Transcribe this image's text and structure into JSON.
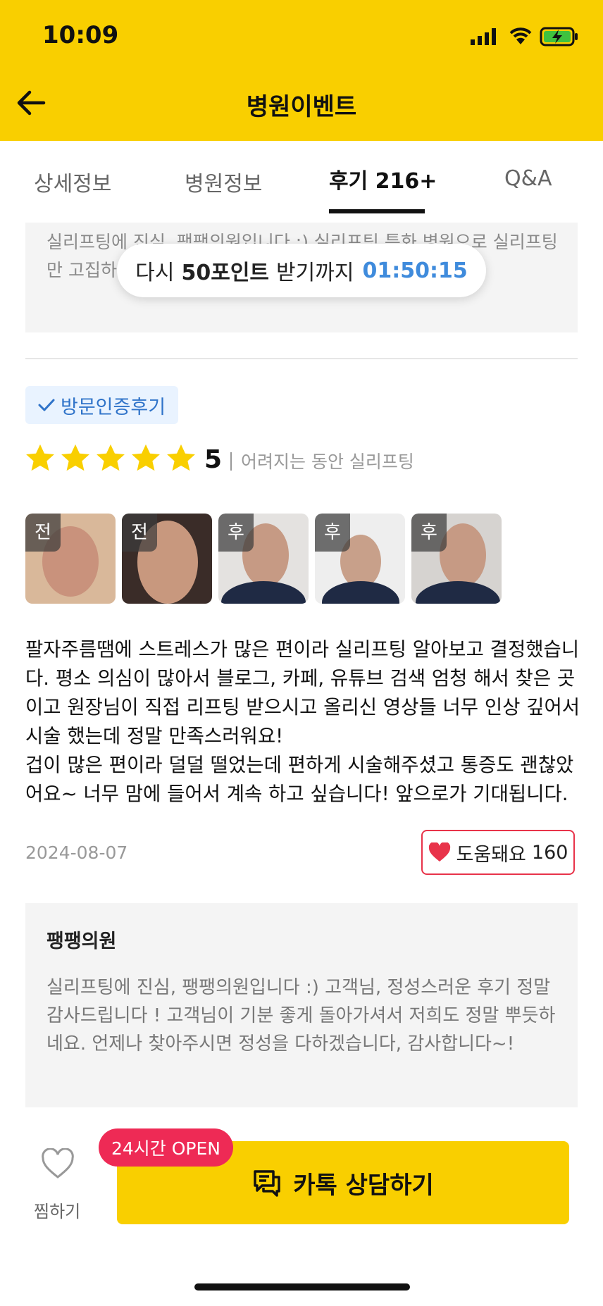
{
  "status_bar": {
    "time": "10:09"
  },
  "header": {
    "title": "병원이벤트",
    "back_icon": "back-arrow-icon"
  },
  "tabs": [
    {
      "label": "상세정보",
      "active": false
    },
    {
      "label": "병원정보",
      "active": false
    },
    {
      "label": "후기 216+",
      "active": true
    },
    {
      "label": "Q&A",
      "active": false
    }
  ],
  "prev_reply": {
    "text": "실리프팅에 진심, 팽팽의원입니다 :) 실리프팅 특화 병원으로 실리프팅만 고집하며 최선을 다하고 있습니다, 언제나 찾아주세요 :-)"
  },
  "toast": {
    "prefix": "다시",
    "points": "50포인트",
    "suffix": "받기까지",
    "timer": "01:50:15"
  },
  "review": {
    "badge": "방문인증후기",
    "rating": "5",
    "stars": 5,
    "title": "어려지는 동안 실리프팅",
    "photos": [
      {
        "tag": "전",
        "bg": "#d9b89a"
      },
      {
        "tag": "전",
        "bg": "#3a2c28"
      },
      {
        "tag": "후",
        "bg": "#e4e2e0"
      },
      {
        "tag": "후",
        "bg": "#eeeeee"
      },
      {
        "tag": "후",
        "bg": "#d6d3d0"
      }
    ],
    "body": "팔자주름땜에 스트레스가 많은 편이라 실리프팅 알아보고 결정했습니다. 평소 의심이 많아서 블로그, 카페, 유튜브 검색 엄청 해서 찾은 곳이고 원장님이 직접 리프팅 받으시고 올리신 영상들 너무 인상 깊어서 시술 했는데 정말 만족스러워요!\n겁이 많은 편이라 덜덜 떨었는데 편하게 시술해주셨고 통증도 괜찮았어요~ 너무 맘에 들어서 계속 하고 싶습니다! 앞으로가 기대됩니다.",
    "date": "2024-08-07",
    "helpful_label": "도움돼요",
    "helpful_count": "160"
  },
  "reply": {
    "name": "팽팽의원",
    "text": "실리프팅에 진심, 팽팽의원입니다 :) 고객님, 정성스러운 후기 정말 감사드립니다 ! 고객님이 기분 좋게 돌아가셔서 저희도 정말 뿌듯하네요. 언제나 찾아주시면 정성을 다하겠습니다, 감사합니다~!"
  },
  "bottom_bar": {
    "wish_label": "찜하기",
    "open_badge": "24시간 OPEN",
    "kakao_label": "카톡 상담하기"
  },
  "colors": {
    "brand_yellow": "#f9cf00",
    "star": "#f9cf00",
    "heart": "#e8334a",
    "timer": "#3f8bdc",
    "badge_red": "#ee2a55"
  }
}
